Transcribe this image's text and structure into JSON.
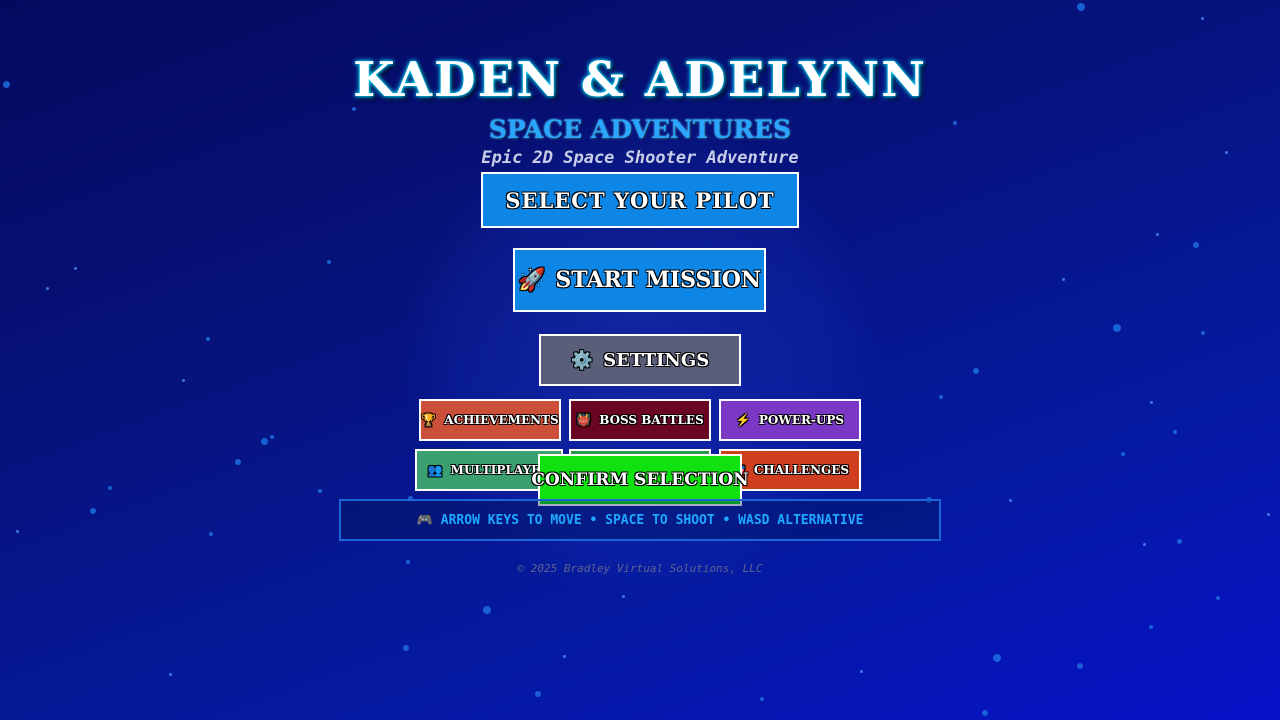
{
  "header": {
    "title": "KADEN & ADELYNN",
    "subtitle": "SPACE ADVENTURES",
    "tagline": "Epic 2D Space Shooter Adventure"
  },
  "menu": {
    "select_pilot": "SELECT YOUR PILOT",
    "start_mission": {
      "icon": "🚀",
      "label": "START MISSION"
    },
    "settings": {
      "icon": "⚙️",
      "label": "SETTINGS"
    },
    "achievements": {
      "icon": "🏆",
      "label": "ACHIEVEMENTS"
    },
    "boss_battles": {
      "icon": "👹",
      "label": "BOSS BATTLES"
    },
    "power_ups": {
      "icon": "⚡",
      "label": "POWER-UPS"
    },
    "multiplayer": {
      "icon": "👥",
      "label": "MULTIPLAYER"
    },
    "challenges": {
      "icon": "🎯",
      "label": "CHALLENGES"
    },
    "confirm": "CONFIRM SELECTION"
  },
  "controls": {
    "icon": "🎮",
    "text": "ARROW KEYS TO MOVE • SPACE TO SHOOT • WASD ALTERNATIVE"
  },
  "footer": {
    "copyright": "© 2025 Bradley Virtual Solutions, LLC"
  },
  "colors": {
    "primary_button": "#0e86e6",
    "settings_button": "#5a5e78",
    "achievements": "#cc4f3a",
    "boss_battles": "#6a0622",
    "power_ups": "#7a38c4",
    "multiplayer": "#3aa070",
    "challenges": "#d03e20",
    "confirm": "#11e011",
    "controls_text": "#1fa8ff"
  }
}
